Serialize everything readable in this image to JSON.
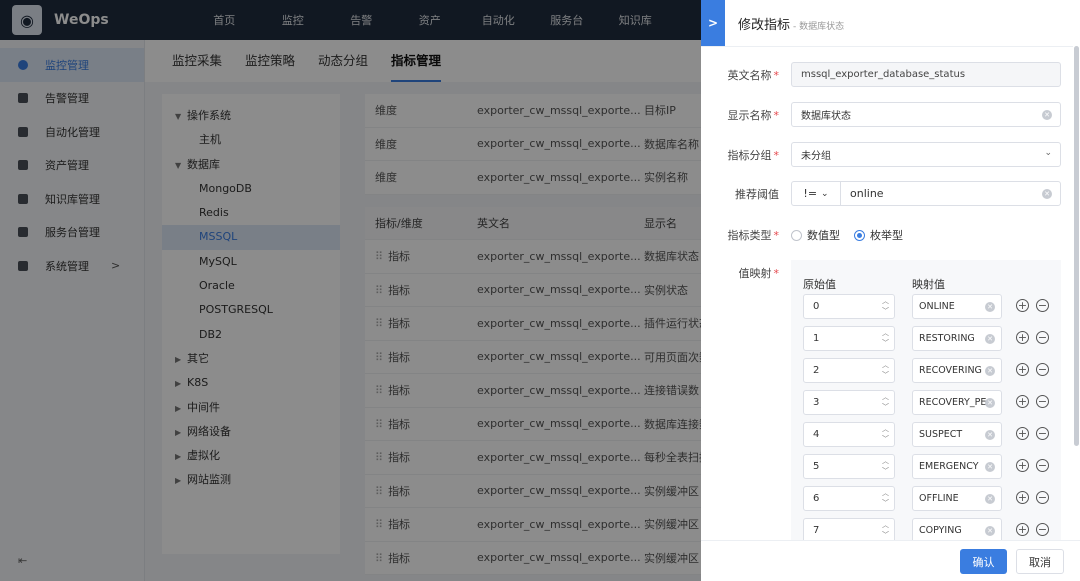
{
  "app": {
    "brand": "WeOps",
    "logo_icon": "owl-logo-icon"
  },
  "topnav": [
    "首页",
    "监控",
    "告警",
    "资产",
    "自动化",
    "服务台",
    "知识库"
  ],
  "sidebar": {
    "items": [
      {
        "label": "监控管理",
        "icon": "location-icon",
        "active": true
      },
      {
        "label": "告警管理",
        "icon": "alarm-icon"
      },
      {
        "label": "自动化管理",
        "icon": "robot-icon"
      },
      {
        "label": "资产管理",
        "icon": "layers-icon"
      },
      {
        "label": "知识库管理",
        "icon": "book-icon"
      },
      {
        "label": "服务台管理",
        "icon": "clipboard-icon"
      },
      {
        "label": "系统管理",
        "icon": "gear-icon",
        "arrow": ">"
      }
    ],
    "collapse": "⇤"
  },
  "subtabs": [
    "监控采集",
    "监控策略",
    "动态分组",
    "指标管理"
  ],
  "tree": [
    {
      "label": "操作系统",
      "level": 0,
      "caret": "▼"
    },
    {
      "label": "主机",
      "level": 1
    },
    {
      "label": "数据库",
      "level": 0,
      "caret": "▼"
    },
    {
      "label": "MongoDB",
      "level": 1
    },
    {
      "label": "Redis",
      "level": 1
    },
    {
      "label": "MSSQL",
      "level": 1,
      "selected": true
    },
    {
      "label": "MySQL",
      "level": 1
    },
    {
      "label": "Oracle",
      "level": 1
    },
    {
      "label": "POSTGRESQL",
      "level": 1
    },
    {
      "label": "DB2",
      "level": 1
    },
    {
      "label": "其它",
      "level": 0,
      "caret": "▶"
    },
    {
      "label": "K8S",
      "level": 0,
      "caret": "▶"
    },
    {
      "label": "中间件",
      "level": 0,
      "caret": "▶"
    },
    {
      "label": "网络设备",
      "level": 0,
      "caret": "▶"
    },
    {
      "label": "虚拟化",
      "level": 0,
      "caret": "▶"
    },
    {
      "label": "网站监测",
      "level": 0,
      "caret": "▶"
    }
  ],
  "dim_table": {
    "rows": [
      [
        "维度",
        "exporter_cw_mssql_exporte...",
        "目标IP"
      ],
      [
        "维度",
        "exporter_cw_mssql_exporte...",
        "数据库名称"
      ],
      [
        "维度",
        "exporter_cw_mssql_exporte...",
        "实例名称"
      ]
    ]
  },
  "metric_table": {
    "headers": [
      "指标/维度",
      "英文名",
      "显示名"
    ],
    "rows": [
      [
        "指标",
        "exporter_cw_mssql_exporte...",
        "数据库状态"
      ],
      [
        "指标",
        "exporter_cw_mssql_exporte...",
        "实例状态"
      ],
      [
        "指标",
        "exporter_cw_mssql_exporte...",
        "插件运行状态"
      ],
      [
        "指标",
        "exporter_cw_mssql_exporte...",
        "可用页面次数"
      ],
      [
        "指标",
        "exporter_cw_mssql_exporte...",
        "连接错误数"
      ],
      [
        "指标",
        "exporter_cw_mssql_exporte...",
        "数据库连接数"
      ],
      [
        "指标",
        "exporter_cw_mssql_exporte...",
        "每秒全表扫描"
      ],
      [
        "指标",
        "exporter_cw_mssql_exporte...",
        "实例缓冲区"
      ],
      [
        "指标",
        "exporter_cw_mssql_exporte...",
        "实例缓冲区"
      ],
      [
        "指标",
        "exporter_cw_mssql_exporte...",
        "实例缓冲区"
      ]
    ]
  },
  "drawer": {
    "close_icon": "chevron-right-icon",
    "title": "修改指标",
    "subtitle": "- 数据库状态",
    "fields": {
      "en_name": {
        "label": "英文名称",
        "value": "mssql_exporter_database_status"
      },
      "display_name": {
        "label": "显示名称",
        "value": "数据库状态"
      },
      "group": {
        "label": "指标分组",
        "value": "未分组"
      },
      "threshold": {
        "label": "推荐阈值",
        "operator": "!=",
        "value": "online"
      },
      "type": {
        "label": "指标类型",
        "options": [
          "数值型",
          "枚举型"
        ],
        "selected": "枚举型"
      },
      "value_map": {
        "label": "值映射",
        "col_raw": "原始值",
        "col_mapped": "映射值"
      }
    },
    "mappings": [
      {
        "raw": "0",
        "mapped": "ONLINE"
      },
      {
        "raw": "1",
        "mapped": "RESTORING"
      },
      {
        "raw": "2",
        "mapped": "RECOVERING"
      },
      {
        "raw": "3",
        "mapped": "RECOVERY_PE"
      },
      {
        "raw": "4",
        "mapped": "SUSPECT"
      },
      {
        "raw": "5",
        "mapped": "EMERGENCY"
      },
      {
        "raw": "6",
        "mapped": "OFFLINE"
      },
      {
        "raw": "7",
        "mapped": "COPYING"
      }
    ],
    "confirm": "确认",
    "cancel": "取消"
  },
  "colors": {
    "accent": "#3a7de0",
    "nav_bg": "#1f2c3f",
    "required": "#e5484d"
  }
}
